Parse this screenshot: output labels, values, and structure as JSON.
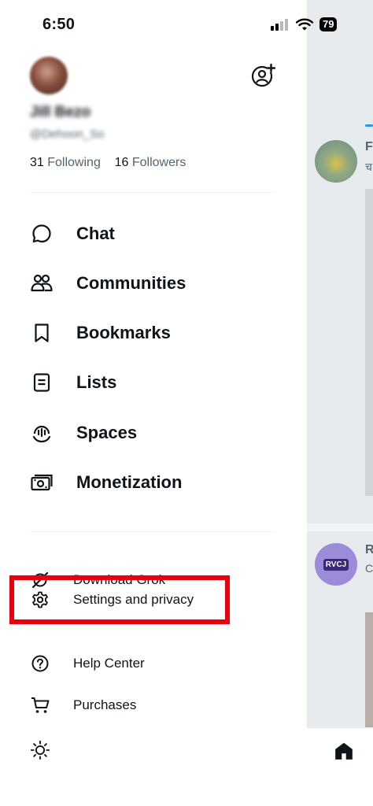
{
  "status_bar": {
    "time": "6:50",
    "battery": "79"
  },
  "profile": {
    "name": "Jill Bezo",
    "handle": "@Dehoon_So",
    "following_count": "31",
    "following_label": "Following",
    "followers_count": "16",
    "followers_label": "Followers"
  },
  "menu": [
    {
      "label": "Chat",
      "icon": "chat-icon"
    },
    {
      "label": "Communities",
      "icon": "communities-icon"
    },
    {
      "label": "Bookmarks",
      "icon": "bookmark-icon"
    },
    {
      "label": "Lists",
      "icon": "list-icon"
    },
    {
      "label": "Spaces",
      "icon": "spaces-icon"
    },
    {
      "label": "Monetization",
      "icon": "monetization-icon"
    }
  ],
  "secondary_menu": [
    {
      "label": "Download Grok",
      "icon": "grok-icon"
    },
    {
      "label": "Settings and privacy",
      "icon": "gear-icon",
      "highlighted": true
    },
    {
      "label": "Help Center",
      "icon": "help-icon"
    },
    {
      "label": "Purchases",
      "icon": "cart-icon"
    }
  ],
  "background_feed": {
    "post1_initial": "F",
    "post1_sub": "च",
    "post2_initial": "R",
    "post2_sub": "C",
    "post2_avatar_text": "RVCJ"
  },
  "colors": {
    "highlight": "#e8000d",
    "text": "#0f1419",
    "secondary": "#536471",
    "accent": "#1d9bf0"
  }
}
